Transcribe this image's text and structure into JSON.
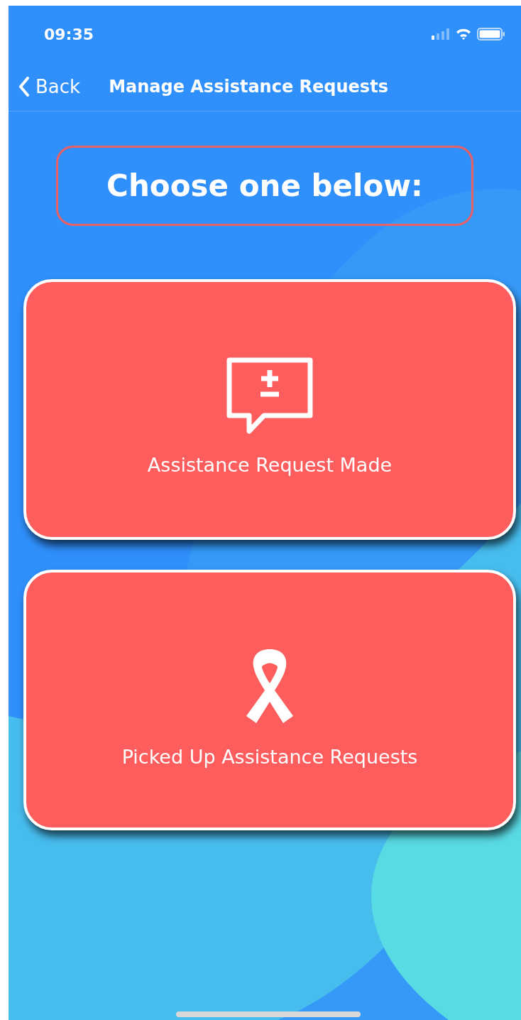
{
  "status_bar": {
    "time": "09:35"
  },
  "nav": {
    "back": "Back",
    "title": "Manage Assistance Requests"
  },
  "heading": "Choose one below:",
  "options": [
    {
      "kind": "plus-minus-message",
      "label": "Assistance Request Made"
    },
    {
      "kind": "ribbon",
      "label": "Picked Up Assistance Requests"
    }
  ]
}
